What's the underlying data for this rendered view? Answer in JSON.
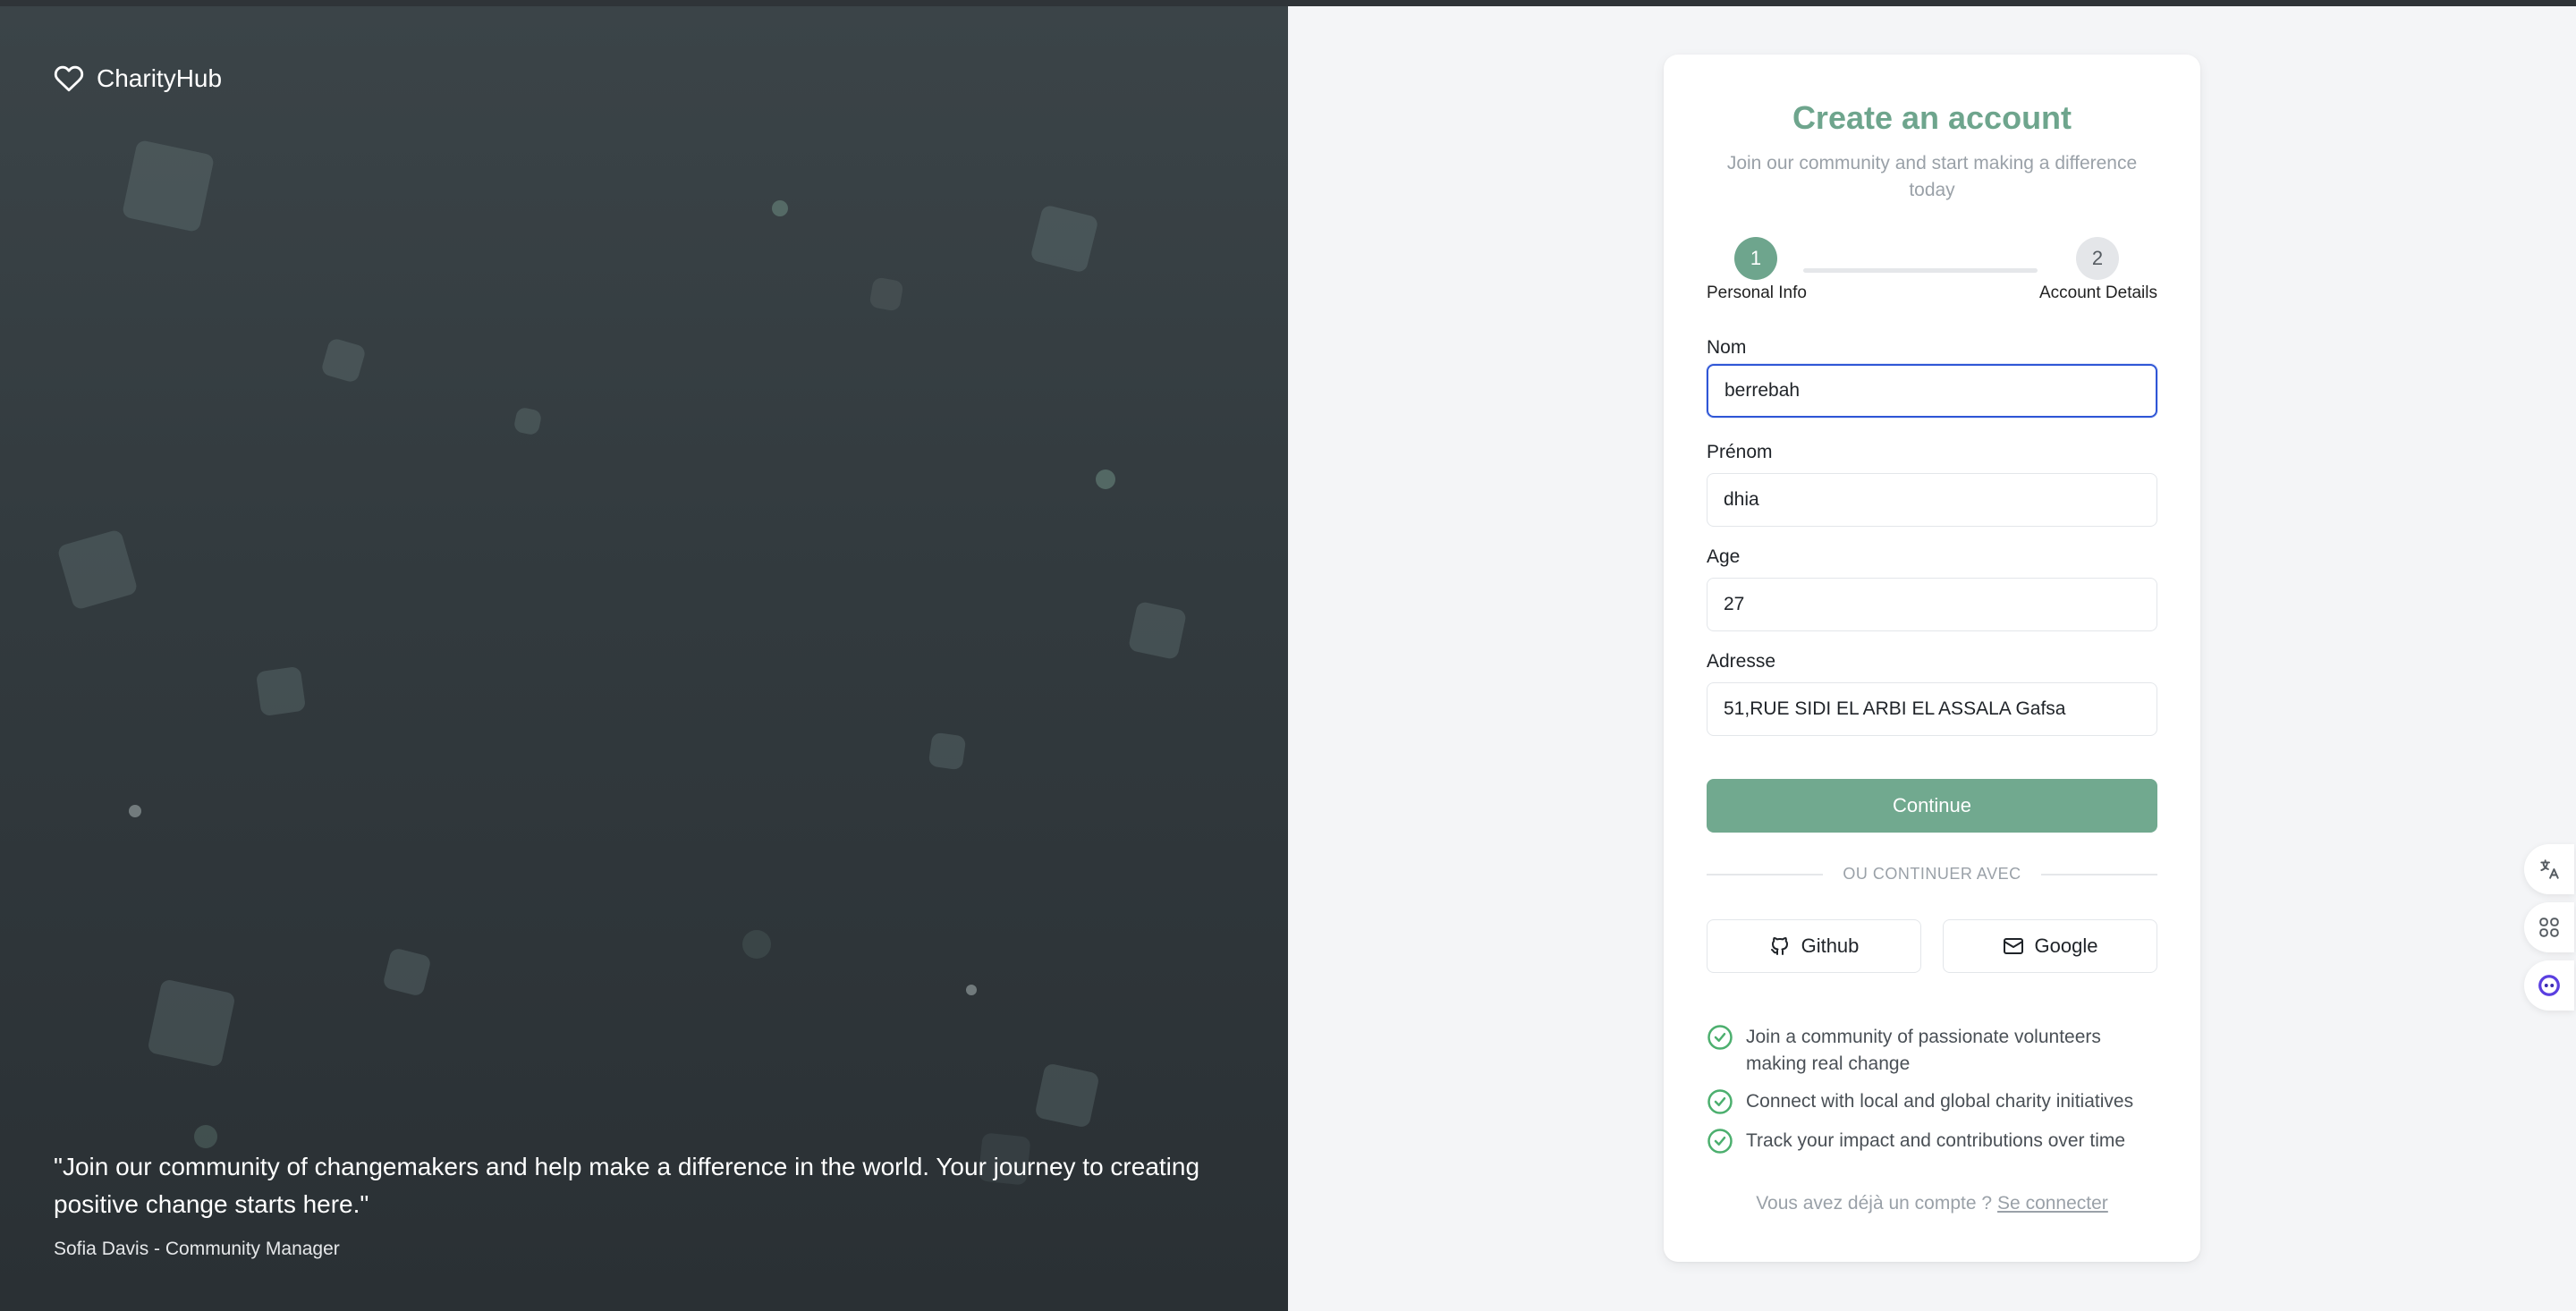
{
  "brand": {
    "name": "CharityHub"
  },
  "left": {
    "quote": "\"Join our community of changemakers and help make a difference in the world. Your journey to creating positive change starts here.\"",
    "author": "Sofia Davis - Community Manager"
  },
  "card": {
    "title": "Create an account",
    "subtitle": "Join our community and start making a difference today",
    "steps": [
      {
        "number": "1",
        "label": "Personal Info"
      },
      {
        "number": "2",
        "label": "Account Details"
      }
    ],
    "fields": {
      "nom": {
        "label": "Nom",
        "value": "berrebah"
      },
      "prenom": {
        "label": "Prénom",
        "value": "dhia"
      },
      "age": {
        "label": "Age",
        "value": "27"
      },
      "adresse": {
        "label": "Adresse",
        "value": "51,RUE SIDI EL ARBI EL ASSALA Gafsa"
      }
    },
    "continue_label": "Continue",
    "divider_text": "OU CONTINUER AVEC",
    "social": {
      "github": "Github",
      "google": "Google"
    },
    "features": [
      "Join a community of passionate volunteers making real change",
      "Connect with local and global charity initiatives",
      "Track your impact and contributions over time"
    ],
    "login_prompt": "Vous avez déjà un compte ?",
    "login_link": "Se connecter"
  },
  "colors": {
    "accent": "#6ea58d",
    "focus": "#2f56d6",
    "left_panel": "#353d41"
  }
}
